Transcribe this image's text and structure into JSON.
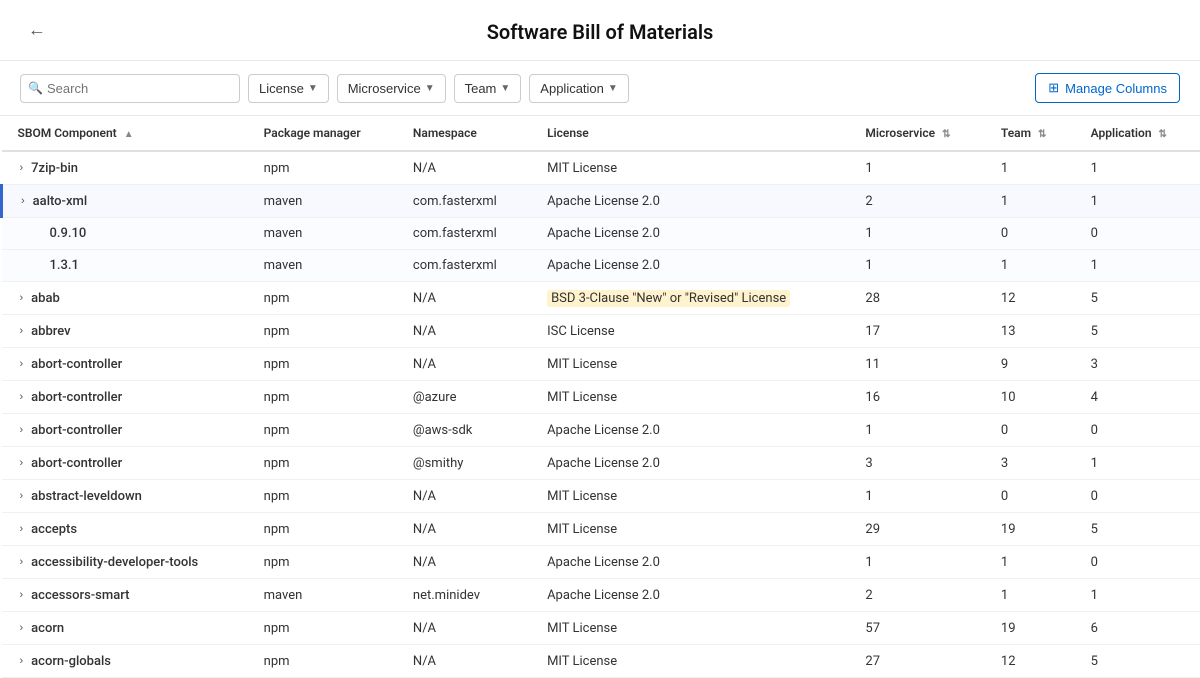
{
  "header": {
    "title": "Software Bill of Materials",
    "back_label": "←"
  },
  "toolbar": {
    "search_placeholder": "Search",
    "filters": [
      {
        "id": "license",
        "label": "License"
      },
      {
        "id": "microservice",
        "label": "Microservice"
      },
      {
        "id": "team",
        "label": "Team"
      },
      {
        "id": "application",
        "label": "Application"
      }
    ],
    "manage_columns_label": "Manage Columns",
    "manage_columns_icon": "⊞"
  },
  "table": {
    "columns": [
      {
        "id": "component",
        "label": "SBOM Component",
        "sort": "asc"
      },
      {
        "id": "package_manager",
        "label": "Package manager"
      },
      {
        "id": "namespace",
        "label": "Namespace"
      },
      {
        "id": "license",
        "label": "License"
      },
      {
        "id": "microservice",
        "label": "Microservice",
        "sortable": true
      },
      {
        "id": "team",
        "label": "Team",
        "sortable": true
      },
      {
        "id": "application",
        "label": "Application",
        "sortable": true
      }
    ],
    "rows": [
      {
        "id": 1,
        "expandable": true,
        "expanded": false,
        "component": "7zip-bin",
        "package_manager": "npm",
        "namespace": "N/A",
        "license": "MIT License",
        "microservice": "1",
        "team": "1",
        "application": "1",
        "highlight": false
      },
      {
        "id": 2,
        "expandable": true,
        "expanded": true,
        "component": "aalto-xml",
        "package_manager": "maven",
        "namespace": "com.fasterxml",
        "license": "Apache License 2.0",
        "microservice": "2",
        "team": "1",
        "application": "1",
        "highlight": true
      },
      {
        "id": 3,
        "expandable": false,
        "expanded": false,
        "child": true,
        "component": "0.9.10",
        "package_manager": "maven",
        "namespace": "com.fasterxml",
        "license": "Apache License 2.0",
        "microservice": "1",
        "team": "0",
        "application": "0",
        "highlight": false
      },
      {
        "id": 4,
        "expandable": false,
        "expanded": false,
        "child": true,
        "component": "1.3.1",
        "package_manager": "maven",
        "namespace": "com.fasterxml",
        "license": "Apache License 2.0",
        "microservice": "1",
        "team": "1",
        "application": "1",
        "highlight": false
      },
      {
        "id": 5,
        "expandable": true,
        "expanded": false,
        "component": "abab",
        "package_manager": "npm",
        "namespace": "N/A",
        "license": "BSD 3-Clause \"New\" or \"Revised\" License",
        "microservice": "28",
        "team": "12",
        "application": "5",
        "highlight": false
      },
      {
        "id": 6,
        "expandable": true,
        "expanded": false,
        "component": "abbrev",
        "package_manager": "npm",
        "namespace": "N/A",
        "license": "ISC License",
        "microservice": "17",
        "team": "13",
        "application": "5",
        "highlight": false
      },
      {
        "id": 7,
        "expandable": true,
        "expanded": false,
        "component": "abort-controller",
        "package_manager": "npm",
        "namespace": "N/A",
        "license": "MIT License",
        "microservice": "11",
        "team": "9",
        "application": "3",
        "highlight": false
      },
      {
        "id": 8,
        "expandable": true,
        "expanded": false,
        "component": "abort-controller",
        "package_manager": "npm",
        "namespace": "@azure",
        "license": "MIT License",
        "microservice": "16",
        "team": "10",
        "application": "4",
        "highlight": false
      },
      {
        "id": 9,
        "expandable": true,
        "expanded": false,
        "component": "abort-controller",
        "package_manager": "npm",
        "namespace": "@aws-sdk",
        "license": "Apache License 2.0",
        "microservice": "1",
        "team": "0",
        "application": "0",
        "highlight": false
      },
      {
        "id": 10,
        "expandable": true,
        "expanded": false,
        "component": "abort-controller",
        "package_manager": "npm",
        "namespace": "@smithy",
        "license": "Apache License 2.0",
        "microservice": "3",
        "team": "3",
        "application": "1",
        "highlight": false
      },
      {
        "id": 11,
        "expandable": true,
        "expanded": false,
        "component": "abstract-leveldown",
        "package_manager": "npm",
        "namespace": "N/A",
        "license": "MIT License",
        "microservice": "1",
        "team": "0",
        "application": "0",
        "highlight": false
      },
      {
        "id": 12,
        "expandable": true,
        "expanded": false,
        "component": "accepts",
        "package_manager": "npm",
        "namespace": "N/A",
        "license": "MIT License",
        "microservice": "29",
        "team": "19",
        "application": "5",
        "highlight": false
      },
      {
        "id": 13,
        "expandable": true,
        "expanded": false,
        "component": "accessibility-developer-tools",
        "package_manager": "npm",
        "namespace": "N/A",
        "license": "Apache License 2.0",
        "microservice": "1",
        "team": "1",
        "application": "0",
        "highlight": false
      },
      {
        "id": 14,
        "expandable": true,
        "expanded": false,
        "component": "accessors-smart",
        "package_manager": "maven",
        "namespace": "net.minidev",
        "license": "Apache License 2.0",
        "microservice": "2",
        "team": "1",
        "application": "1",
        "highlight": false
      },
      {
        "id": 15,
        "expandable": true,
        "expanded": false,
        "component": "acorn",
        "package_manager": "npm",
        "namespace": "N/A",
        "license": "MIT License",
        "microservice": "57",
        "team": "19",
        "application": "6",
        "highlight": false
      },
      {
        "id": 16,
        "expandable": true,
        "expanded": false,
        "component": "acorn-globals",
        "package_manager": "npm",
        "namespace": "N/A",
        "license": "MIT License",
        "microservice": "27",
        "team": "12",
        "application": "5",
        "highlight": false
      }
    ]
  }
}
